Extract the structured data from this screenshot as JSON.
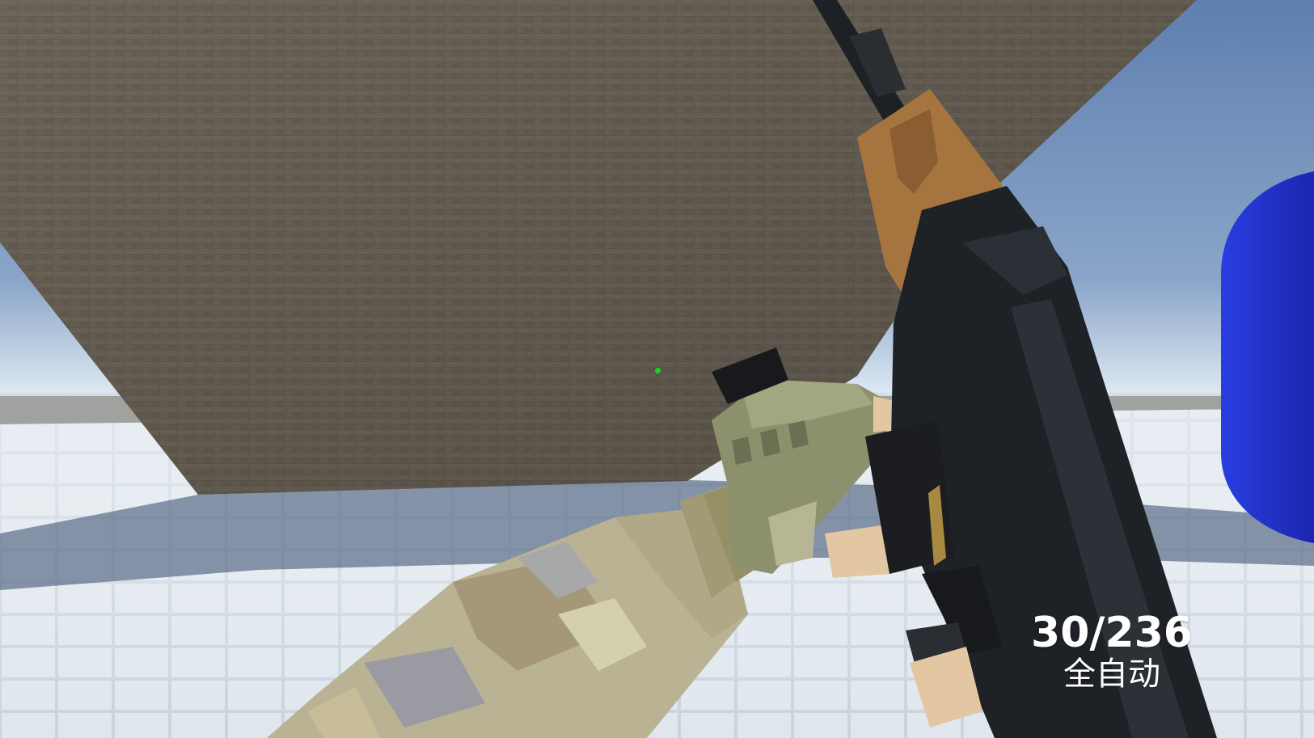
{
  "hud": {
    "ammo": {
      "magazine": "30",
      "reserve": "236",
      "display": "30/236"
    },
    "fire_mode": "全自动",
    "crosshair_color": "#19d51e"
  },
  "colors": {
    "sky_top": "#6f89b1",
    "sky_horizon": "#dbe7f2",
    "wall_stone": "#6a6155",
    "floor_tile": "#d2dbe4",
    "floor_shadow": "#596b85",
    "rifle_body": "#1e2125",
    "rifle_wood": "#a6743f",
    "glove": "#8c8f6c",
    "sleeve_camo_light": "#c9c4a0",
    "sleeve_camo_mid": "#9e9270",
    "sleeve_camo_grey": "#9a9aa0",
    "skin": "#e2c7a2",
    "target_blue": "#2231c6"
  },
  "icons": [
    "crosshair-dot-icon"
  ]
}
